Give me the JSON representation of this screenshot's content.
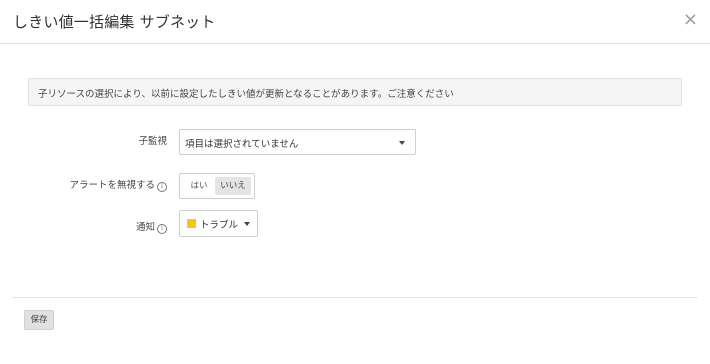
{
  "dialog": {
    "title": "しきい値一括編集 サブネット",
    "close_glyph": "×"
  },
  "notice": {
    "text": "子リソースの選択により、以前に設定したしきい値が更新となることがあります。ご注意ください"
  },
  "form": {
    "child_monitor": {
      "label": "子監視",
      "value": "項目は選択されていません"
    },
    "ignore_alert": {
      "label": "アラートを無視する",
      "info_glyph": "i",
      "options": [
        "はい",
        "いいえ"
      ],
      "selected": "いいえ"
    },
    "notification": {
      "label": "通知",
      "info_glyph": "i",
      "value": "トラブル",
      "color": "#f5c518"
    }
  },
  "footer": {
    "save_label": "保存"
  }
}
